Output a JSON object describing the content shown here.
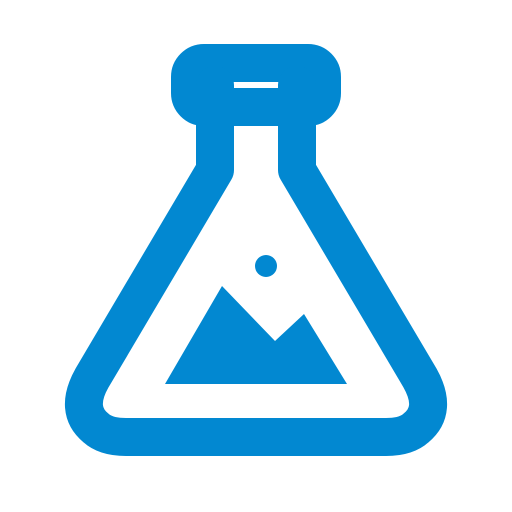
{
  "icon": {
    "name": "flask-image-icon",
    "color": "#0288d1",
    "background": "#ffffff"
  }
}
